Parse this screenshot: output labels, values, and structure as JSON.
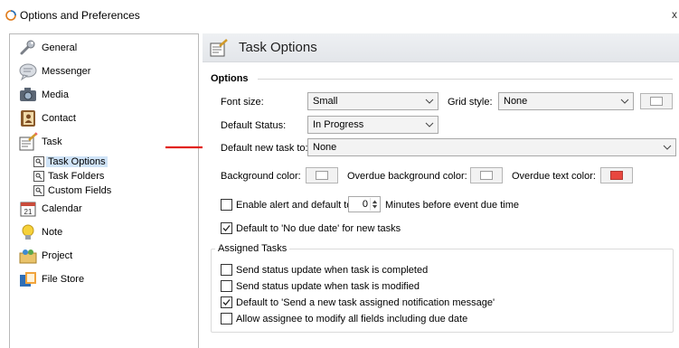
{
  "window": {
    "title": "Options and Preferences",
    "close_glyph": "x"
  },
  "sidebar": {
    "items": [
      {
        "label": "General",
        "icon": "wrench-icon"
      },
      {
        "label": "Messenger",
        "icon": "speech-bubble-icon"
      },
      {
        "label": "Media",
        "icon": "camera-icon"
      },
      {
        "label": "Contact",
        "icon": "contact-book-icon"
      },
      {
        "label": "Task",
        "icon": "task-pencil-icon"
      },
      {
        "label": "Calendar",
        "icon": "calendar-icon"
      },
      {
        "label": "Note",
        "icon": "lightbulb-icon"
      },
      {
        "label": "Project",
        "icon": "project-people-icon"
      },
      {
        "label": "File Store",
        "icon": "file-store-icon"
      }
    ],
    "task_children": [
      {
        "label": "Task Options",
        "selected": true
      },
      {
        "label": "Task Folders",
        "selected": false
      },
      {
        "label": "Custom Fields",
        "selected": false
      }
    ]
  },
  "panel": {
    "header_title": "Task Options",
    "section_options": "Options",
    "font_size_label": "Font size:",
    "font_size_value": "Small",
    "grid_style_label": "Grid style:",
    "grid_style_value": "None",
    "default_status_label": "Default Status:",
    "default_status_value": "In Progress",
    "default_new_task_label": "Default new task to:",
    "default_new_task_value": "None",
    "background_color_label": "Background color:",
    "overdue_bg_label": "Overdue background color:",
    "overdue_text_label": "Overdue text color:",
    "colors": {
      "background": "#ffffff",
      "overdue_background": "#ffffff",
      "overdue_text": "#e8473f",
      "grid_swatch": "#ffffff"
    },
    "enable_alert_label": "Enable alert and default to",
    "enable_alert_checked": false,
    "alert_minutes_value": "0",
    "minutes_label": "Minutes before event due time",
    "no_due_date_label": "Default to 'No due date' for new tasks",
    "no_due_date_checked": true,
    "assigned_tasks_title": "Assigned Tasks",
    "assigned_options": [
      {
        "label": "Send status update when task is completed",
        "checked": false
      },
      {
        "label": "Send status update when task is modified",
        "checked": false
      },
      {
        "label": "Default to 'Send a new task assigned notification message'",
        "checked": true
      },
      {
        "label": "Allow assignee to modify all fields including due date",
        "checked": false
      }
    ],
    "annotation_arrow_color": "#e2231a"
  }
}
